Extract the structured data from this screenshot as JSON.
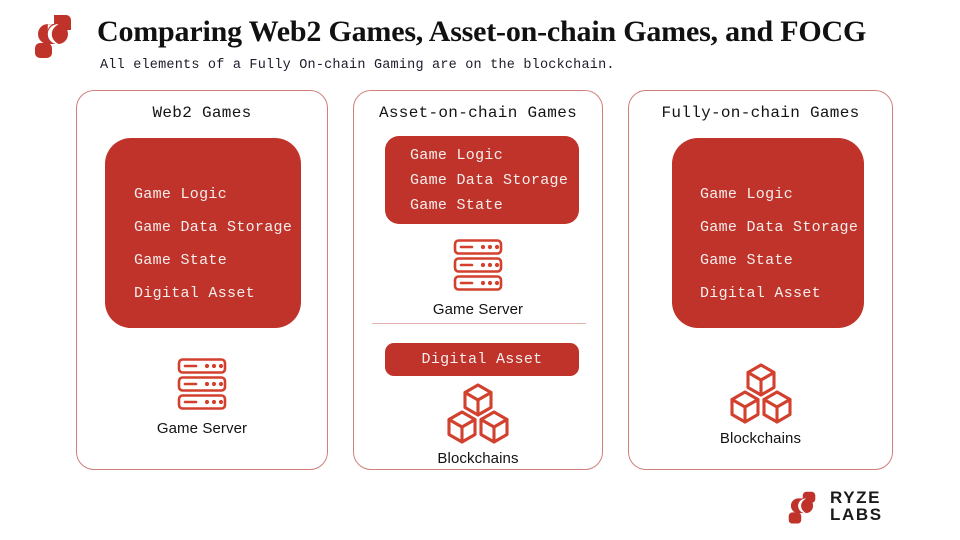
{
  "header": {
    "title": "Comparing Web2 Games, Asset-on-chain Games, and FOCG",
    "subtitle": "All elements of a Fully On-chain Gaming are on the blockchain.",
    "brand_icon": "ryze-logo-mark"
  },
  "accent_colors": {
    "brand_red": "#bf332b",
    "card_border": "#d08079",
    "divider": "#e2b3ad",
    "box_text": "#f4eeec",
    "title_text": "#111111"
  },
  "columns": [
    {
      "id": "web2",
      "title": "Web2 Games",
      "box_items": [
        "Game Logic",
        "Game Data Storage",
        "Game State",
        "Digital Asset"
      ],
      "server_caption": "Game Server",
      "server_icon": "server-rack-icon"
    },
    {
      "id": "asset-on-chain",
      "title": "Asset-on-chain Games",
      "box_items": [
        "Game Logic",
        "Game Data Storage",
        "Game State"
      ],
      "server_caption": "Game Server",
      "server_icon": "server-rack-icon",
      "chain_box_item": "Digital Asset",
      "chain_caption": "Blockchains",
      "chain_icon": "blockchain-cubes-icon"
    },
    {
      "id": "fully-on-chain",
      "title": "Fully-on-chain Games",
      "box_items": [
        "Game Logic",
        "Game Data Storage",
        "Game State",
        "Digital Asset"
      ],
      "chain_caption": "Blockchains",
      "chain_icon": "blockchain-cubes-icon"
    }
  ],
  "footer": {
    "wordmark_line1": "RYZE",
    "wordmark_line2": "LABS",
    "mark_icon": "ryze-logo-mark"
  }
}
